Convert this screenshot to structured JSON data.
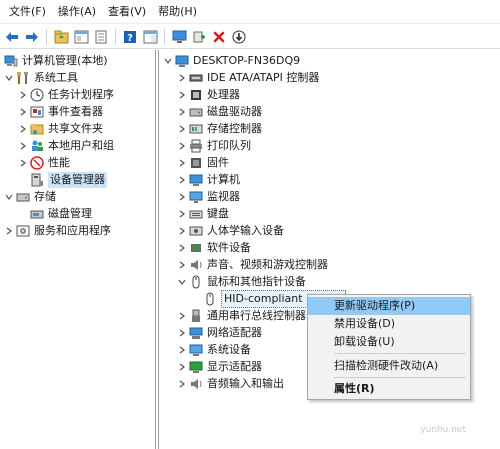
{
  "menubar": {
    "items": [
      "文件(F)",
      "操作(A)",
      "查看(V)",
      "帮助(H)"
    ]
  },
  "toolbar": {
    "icons": [
      "back-arrow-icon",
      "forward-arrow-icon",
      "up-folder-icon",
      "show-hide-tree-icon",
      "properties-icon",
      "help-icon",
      "view-icon",
      "monitor-icon",
      "scan-hardware-icon",
      "uninstall-x-icon",
      "update-driver-icon"
    ],
    "colors": {
      "arrow": "#2a6fbd",
      "delete": "#d62020",
      "help": "#1c5fb6",
      "green": "#2f9d3a"
    }
  },
  "left_tree": {
    "items": [
      {
        "label": "计算机管理(本地)",
        "icon": "computer-management-icon"
      },
      {
        "label": "系统工具",
        "icon": "tools-icon"
      },
      {
        "label": "任务计划程序",
        "icon": "clock-icon"
      },
      {
        "label": "事件查看器",
        "icon": "event-viewer-icon"
      },
      {
        "label": "共享文件夹",
        "icon": "shared-folder-icon"
      },
      {
        "label": "本地用户和组",
        "icon": "users-icon"
      },
      {
        "label": "性能",
        "icon": "performance-icon"
      },
      {
        "label": "设备管理器",
        "icon": "device-manager-icon"
      },
      {
        "label": "存储",
        "icon": "storage-icon"
      },
      {
        "label": "磁盘管理",
        "icon": "disk-icon"
      },
      {
        "label": "服务和应用程序",
        "icon": "services-icon"
      }
    ]
  },
  "device_tree": {
    "root": "DESKTOP-FN36DQ9",
    "items": [
      {
        "label": "IDE ATA/ATAPI 控制器",
        "icon": "ide-controller-icon"
      },
      {
        "label": "处理器",
        "icon": "processor-icon"
      },
      {
        "label": "磁盘驱动器",
        "icon": "disk-drive-icon"
      },
      {
        "label": "存储控制器",
        "icon": "storage-controller-icon"
      },
      {
        "label": "打印队列",
        "icon": "printer-icon"
      },
      {
        "label": "固件",
        "icon": "firmware-icon"
      },
      {
        "label": "计算机",
        "icon": "computer-icon"
      },
      {
        "label": "监视器",
        "icon": "monitor-icon"
      },
      {
        "label": "键盘",
        "icon": "keyboard-icon"
      },
      {
        "label": "人体学输入设备",
        "icon": "hid-icon"
      },
      {
        "label": "软件设备",
        "icon": "software-device-icon"
      },
      {
        "label": "声音、视频和游戏控制器",
        "icon": "speaker-icon"
      },
      {
        "label": "鼠标和其他指针设备",
        "icon": "mouse-icon"
      },
      {
        "label": "HID-compliant mouse",
        "icon": "mouse-icon"
      },
      {
        "label": "通用串行总线控制器",
        "icon": "usb-icon"
      },
      {
        "label": "网络适配器",
        "icon": "network-icon"
      },
      {
        "label": "系统设备",
        "icon": "system-device-icon"
      },
      {
        "label": "显示适配器",
        "icon": "display-adapter-icon"
      },
      {
        "label": "音频输入和输出",
        "icon": "audio-icon"
      }
    ]
  },
  "context_menu": {
    "update_driver": "更新驱动程序(P)",
    "disable_device": "禁用设备(D)",
    "uninstall_device": "卸载设备(U)",
    "scan_hardware": "扫描检测硬件改动(A)",
    "properties": "属性(R)"
  },
  "watermark": "yunhu.net"
}
